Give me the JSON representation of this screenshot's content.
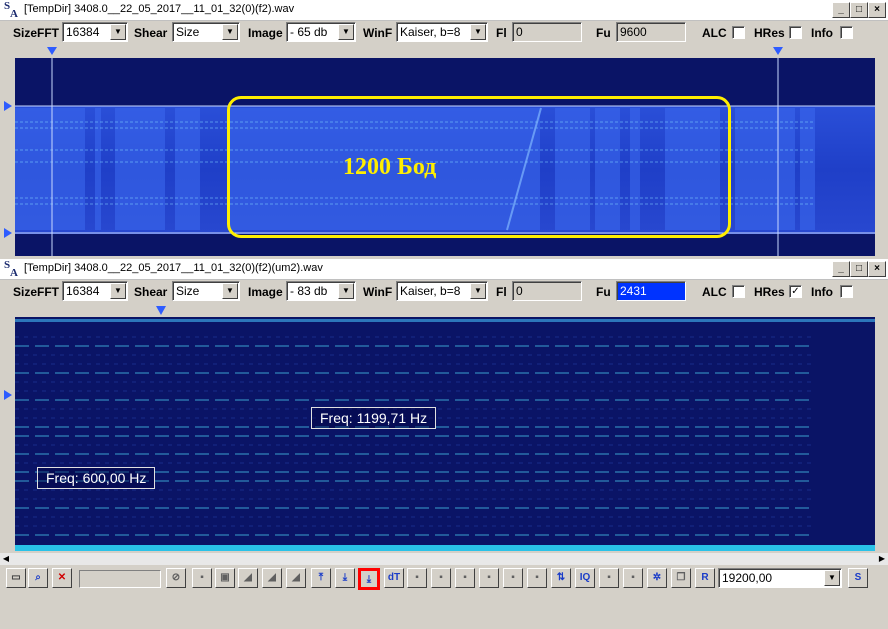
{
  "top_window": {
    "title": "[TempDir] 3408.0__22_05_2017__11_01_32(0)(f2).wav",
    "sizefft_label": "SizeFFT",
    "sizefft_value": "16384",
    "shear_label": "Shear",
    "shear_value": "Size",
    "image_label": "Image",
    "image_value": "- 65 db",
    "winf_label": "WinF",
    "winf_value": "Kaiser, b=8",
    "fi_label": "Fl",
    "fi_value": "0",
    "fu_label": "Fu",
    "fu_value": "9600",
    "alc_label": "ALC",
    "hres_label": "HRes",
    "info_label": "Info",
    "alc_checked": false,
    "hres_checked": false,
    "info_checked": false,
    "annotation": "1200 Бод"
  },
  "bottom_window": {
    "title": "[TempDir] 3408.0__22_05_2017__11_01_32(0)(f2)(um2).wav",
    "sizefft_label": "SizeFFT",
    "sizefft_value": "16384",
    "shear_label": "Shear",
    "shear_value": "Size",
    "image_label": "Image",
    "image_value": "- 83 db",
    "winf_label": "WinF",
    "winf_value": "Kaiser, b=8",
    "fi_label": "Fl",
    "fi_value": "0",
    "fu_label": "Fu",
    "fu_value": "2431",
    "alc_label": "ALC",
    "hres_label": "HRes",
    "info_label": "Info",
    "alc_checked": false,
    "hres_checked": true,
    "info_checked": false,
    "freq_label_1": "Freq: 1199,71 Hz",
    "freq_label_2": "Freq: 600,00 Hz"
  },
  "bottom_toolbar": {
    "dt_label": "dT",
    "r_label": "R",
    "s_label": "S",
    "iq_label": "IQ",
    "rate_value": "19200,00"
  },
  "colors": {
    "spectrum_bg": "#0a1466",
    "spectrum_band": "#1f3ec8",
    "annotation_yellow": "#ffee00",
    "highlight_red": "#ff0000"
  }
}
